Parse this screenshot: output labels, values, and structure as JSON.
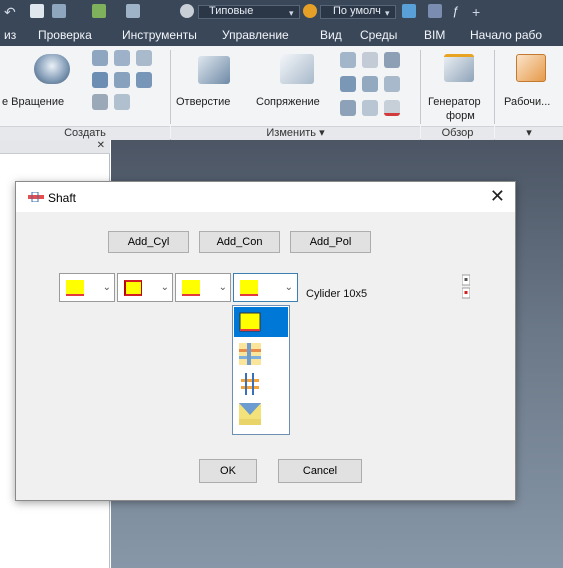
{
  "quick_access": {
    "style_label": "Типовые",
    "material_label": "По умолч"
  },
  "tabs": [
    "из",
    "Проверка",
    "Инструменты",
    "Управление",
    "Вид",
    "Среды",
    "BIM",
    "Начало рабо"
  ],
  "ribbon": {
    "buttons": {
      "revolve": "е Вращение",
      "hole": "Отверстие",
      "fillet": "Сопряжение",
      "generator_line1": "Генератор",
      "generator_line2": "форм",
      "workplane": "Рабочи..."
    },
    "panels": {
      "create": "Создать",
      "modify": "Изменить ▾",
      "explore": "Обзор",
      "more": "▾"
    }
  },
  "dialog": {
    "title": "Shaft",
    "buttons": {
      "add_cyl": "Add_Cyl",
      "add_con": "Add_Con",
      "add_pol": "Add_Pol",
      "ok": "OK",
      "cancel": "Cancel"
    },
    "section_label": "Cylider 10x5",
    "dropdown_items": [
      {
        "icon": "cylinder-icon",
        "selected": true
      },
      {
        "icon": "chamfer-icon",
        "selected": false
      },
      {
        "icon": "groove-icon",
        "selected": false
      },
      {
        "icon": "thread-icon",
        "selected": false
      }
    ]
  },
  "colors": {
    "accent": "#0078d7",
    "swatch_fill": "#ffff00",
    "swatch_edge": "#e63b3b",
    "header_bg": "#3a4759"
  }
}
